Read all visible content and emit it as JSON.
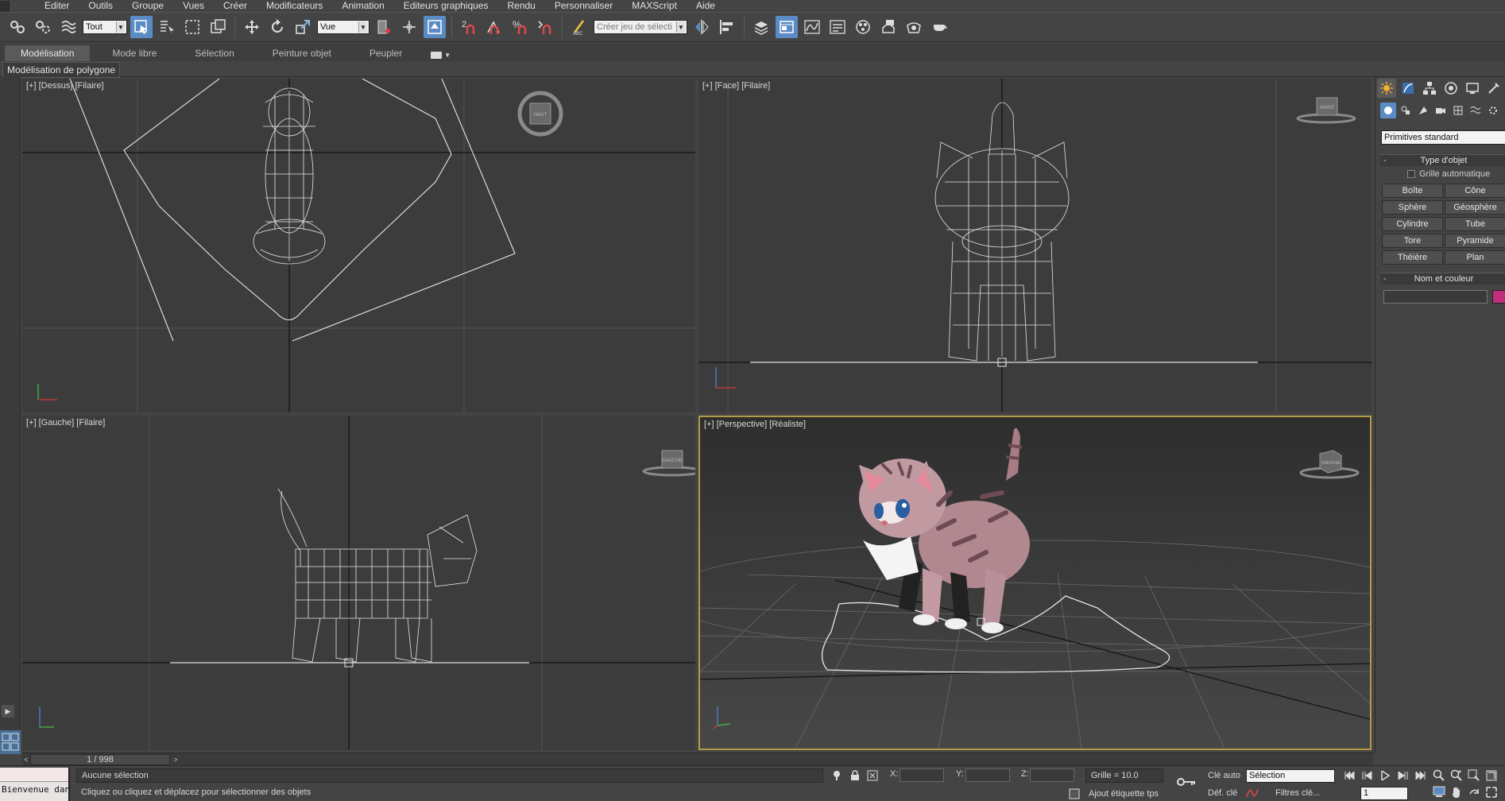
{
  "menu": {
    "items": [
      "Editer",
      "Outils",
      "Groupe",
      "Vues",
      "Créer",
      "Modificateurs",
      "Animation",
      "Editeurs graphiques",
      "Rendu",
      "Personnaliser",
      "MAXScript",
      "Aide"
    ]
  },
  "toolbar": {
    "selection_filter": "Tout",
    "reference_coord": "Vue",
    "named_selection": "Créer jeu de sélecti",
    "snap_label": "2"
  },
  "ribbon": {
    "tabs": [
      "Modélisation",
      "Mode libre",
      "Sélection",
      "Peinture objet",
      "Peupler"
    ],
    "active_tab": "Modélisation",
    "sub_label": "Modélisation de polygone"
  },
  "viewports": {
    "top": {
      "label": "[+] [Dessus] [Filaire]",
      "cube_label": "HAUT"
    },
    "front": {
      "label": "[+] [Face] [Filaire]",
      "cube_label": "AVANT"
    },
    "left": {
      "label": "[+] [Gauche] [Filaire]",
      "cube_label": "GAUCHE"
    },
    "perspective": {
      "label": "[+] [Perspective] [Réaliste]",
      "cube_label": "GAUCHE"
    }
  },
  "command_panel": {
    "primitive_type": "Primitives standard",
    "object_type_title": "Type d'objet",
    "autogrid_label": "Grille automatique",
    "buttons": [
      "Boîte",
      "Cône",
      "Sphère",
      "Géosphère",
      "Cylindre",
      "Tube",
      "Tore",
      "Pyramide",
      "Théière",
      "Plan"
    ],
    "name_color_title": "Nom et couleur",
    "object_color": "#c0307a"
  },
  "time_slider": {
    "frame": "1 / 998"
  },
  "status": {
    "listener_text": "Bienvenue dans",
    "selection_text": "Aucune sélection",
    "prompt_text": "Cliquez ou cliquez et déplacez pour sélectionner des objets",
    "x_label": "X:",
    "y_label": "Y:",
    "z_label": "Z:",
    "grid_text": "Grille = 10.0",
    "auto_key_label": "Clé auto",
    "auto_key_mode": "Sélection",
    "set_key_label": "Déf. clé",
    "key_filters_label": "Filtres clé...",
    "add_time_tag": "Ajout étiquette tps",
    "current_frame": "1"
  },
  "colors": {
    "accent": "#5b8bc4",
    "active_viewport_border": "#b39a47",
    "viewport_bg": "#3c3c3c",
    "wireframe": "#e6e6e6"
  }
}
